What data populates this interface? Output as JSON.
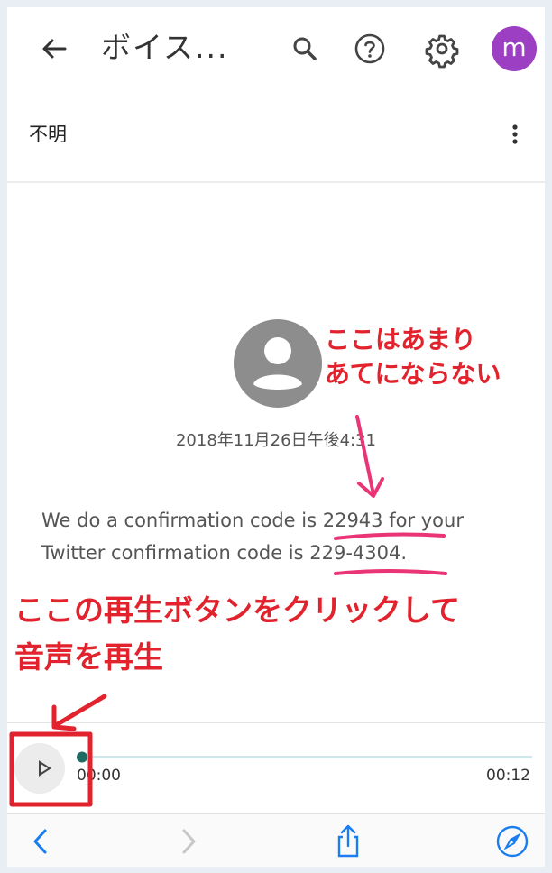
{
  "colors": {
    "accent_red": "#e2222c",
    "avatar_purple": "#9c3fc2",
    "progress_teal": "#1f6b63",
    "ios_blue": "#1a7df0"
  },
  "appbar": {
    "title": "ボイス...",
    "avatar_letter": "m",
    "icons": [
      "back-arrow-icon",
      "search-icon",
      "help-icon",
      "settings-icon"
    ]
  },
  "subheader": {
    "label": "不明",
    "menu_icon": "more-vert-icon"
  },
  "message": {
    "timestamp": "2018年11月26日午後4:31",
    "transcript": "We do a confirmation code is 22943 for your Twitter confirmation code is 229-4304."
  },
  "annotations": {
    "top_note_line1": "ここはあまり",
    "top_note_line2": "あてにならない",
    "bottom_note_line1": "ここの再生ボタンをクリックして",
    "bottom_note_line2": "音声を再生"
  },
  "player": {
    "current_time": "00:00",
    "total_time": "00:12",
    "progress": 0.0
  },
  "toolbar": {
    "icons": [
      "back-chevron-icon",
      "forward-chevron-icon",
      "share-icon",
      "compass-icon"
    ]
  }
}
